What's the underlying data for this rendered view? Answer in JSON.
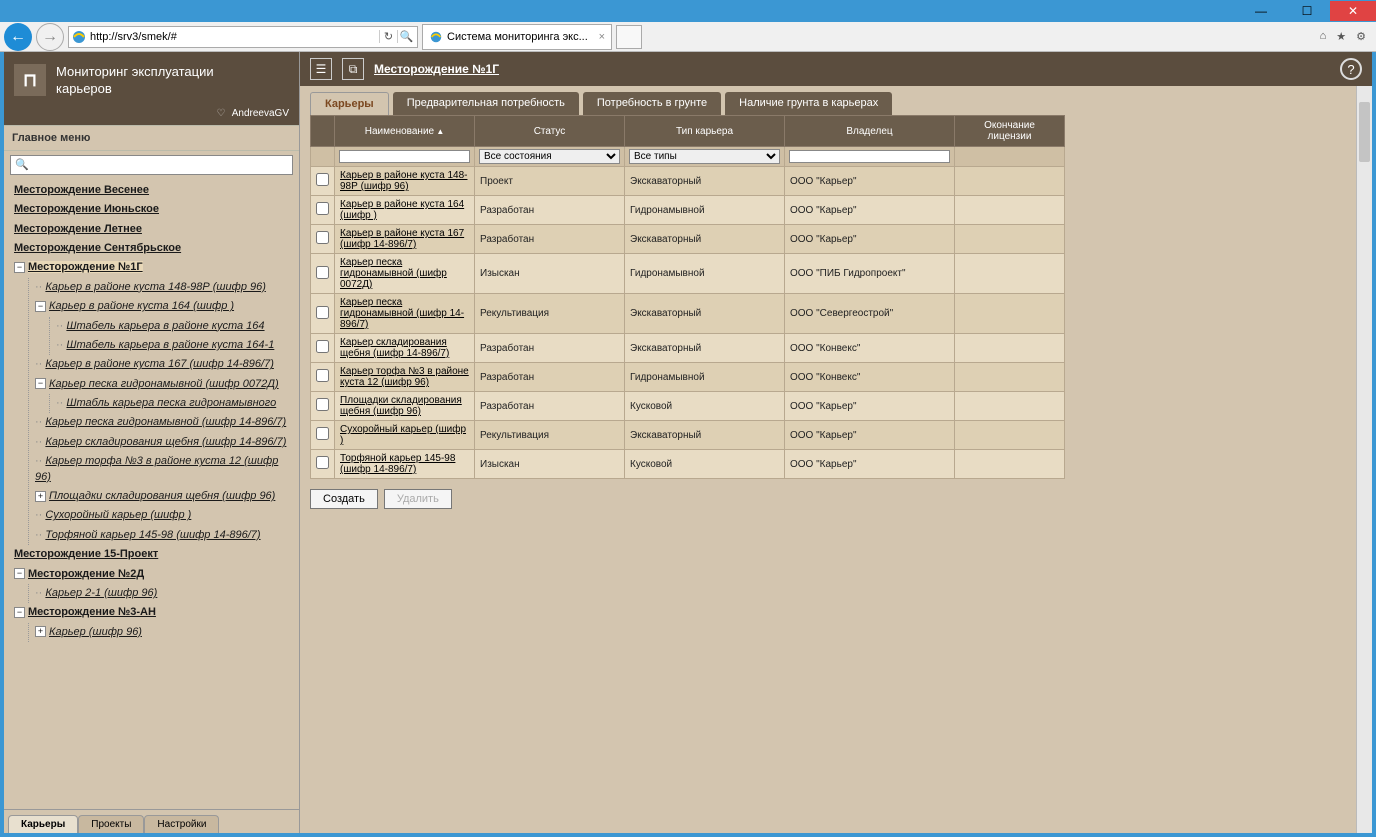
{
  "window": {
    "url": "http://srv3/smek/#",
    "tab_title": "Система мониторинга экс...",
    "tab_close": "×"
  },
  "app": {
    "title_l1": "Мониторинг эксплуатации",
    "title_l2": "карьеров",
    "user": "AndreevaGV"
  },
  "sidebar": {
    "menu_label": "Главное меню",
    "tabs": [
      "Карьеры",
      "Проекты",
      "Настройки"
    ],
    "tree": [
      {
        "label": "Месторождение Весенее",
        "bold": true
      },
      {
        "label": "Месторождение Июньское",
        "bold": true
      },
      {
        "label": "Месторождение Летнее",
        "bold": true
      },
      {
        "label": "Месторождение Сентябрьское",
        "bold": true
      },
      {
        "label": "Месторождение №1Г",
        "bold": true,
        "expanded": true,
        "selected": true,
        "children": [
          {
            "label": "Карьер в районе куста 148-98Р (шифр 96)",
            "italic": true,
            "leaf": true
          },
          {
            "label": "Карьер в районе куста 164 (шифр )",
            "italic": true,
            "expanded": true,
            "children": [
              {
                "label": "Штабель карьера в районе куста 164",
                "italic": true,
                "leaf": true
              },
              {
                "label": "Штабель карьера в районе куста 164-1",
                "italic": true,
                "leaf": true
              }
            ]
          },
          {
            "label": "Карьер в районе куста 167 (шифр 14-896/7)",
            "italic": true,
            "leaf": true
          },
          {
            "label": "Карьер песка гидронамывной (шифр 0072Д)",
            "italic": true,
            "expanded": true,
            "children": [
              {
                "label": "Штабль карьера песка гидронамывного",
                "italic": true,
                "leaf": true
              }
            ]
          },
          {
            "label": "Карьер песка гидронамывной (шифр 14-896/7)",
            "italic": true,
            "leaf": true
          },
          {
            "label": "Карьер складирования щебня (шифр 14-896/7)",
            "italic": true,
            "leaf": true
          },
          {
            "label": "Карьер торфа №3 в районе куста 12 (шифр 96)",
            "italic": true,
            "leaf": true
          },
          {
            "label": "Площадки складирования щебня (шифр 96)",
            "italic": true,
            "collapsed": true
          },
          {
            "label": "Сухоройный карьер (шифр )",
            "italic": true,
            "leaf": true
          },
          {
            "label": "Торфяной карьер 145-98 (шифр 14-896/7)",
            "italic": true,
            "leaf": true
          }
        ]
      },
      {
        "label": "Месторождение 15-Проект",
        "bold": true
      },
      {
        "label": "Месторождение №2Д",
        "bold": true,
        "expanded": true,
        "children": [
          {
            "label": "Карьер 2-1 (шифр 96)",
            "italic": true,
            "leaf": true
          }
        ]
      },
      {
        "label": "Месторождение №3-АН",
        "bold": true,
        "expanded": true,
        "children": [
          {
            "label": "Карьер (шифр 96)",
            "italic": true,
            "collapsed": true
          }
        ]
      }
    ]
  },
  "breadcrumb": {
    "title": "Месторождение №1Г"
  },
  "content_tabs": [
    "Карьеры",
    "Предварительная потребность",
    "Потребность в грунте",
    "Наличие грунта в карьерах"
  ],
  "grid": {
    "columns": [
      "Наименование",
      "Статус",
      "Тип карьера",
      "Владелец",
      "Окончание лицензии"
    ],
    "filter_status": "Все состояния",
    "filter_type": "Все типы",
    "rows": [
      {
        "name": "Карьер в районе куста 148-98Р (шифр 96)",
        "status": "Проект",
        "type": "Экскаваторный",
        "owner": "ООО \"Карьер\"",
        "lic": ""
      },
      {
        "name": "Карьер в районе куста 164 (шифр )",
        "status": "Разработан",
        "type": "Гидронамывной",
        "owner": "ООО \"Карьер\"",
        "lic": ""
      },
      {
        "name": "Карьер в районе куста 167 (шифр 14-896/7)",
        "status": "Разработан",
        "type": "Экскаваторный",
        "owner": "ООО \"Карьер\"",
        "lic": ""
      },
      {
        "name": "Карьер песка гидронамывной (шифр 0072Д)",
        "status": "Изыскан",
        "type": "Гидронамывной",
        "owner": "ООО \"ПИБ Гидропроект\"",
        "lic": ""
      },
      {
        "name": "Карьер песка гидронамывной (шифр 14-896/7)",
        "status": "Рекультивация",
        "type": "Экскаваторный",
        "owner": "ООО \"Севергеострой\"",
        "lic": ""
      },
      {
        "name": "Карьер складирования щебня (шифр 14-896/7)",
        "status": "Разработан",
        "type": "Экскаваторный",
        "owner": "ООО \"Конвекс\"",
        "lic": ""
      },
      {
        "name": "Карьер торфа №3 в районе куста 12 (шифр 96)",
        "status": "Разработан",
        "type": "Гидронамывной",
        "owner": "ООО \"Конвекс\"",
        "lic": ""
      },
      {
        "name": "Площадки складирования щебня (шифр 96)",
        "status": "Разработан",
        "type": "Кусковой",
        "owner": "ООО \"Карьер\"",
        "lic": ""
      },
      {
        "name": "Сухоройный карьер (шифр )",
        "status": "Рекультивация",
        "type": "Экскаваторный",
        "owner": "ООО \"Карьер\"",
        "lic": ""
      },
      {
        "name": "Торфяной карьер 145-98 (шифр 14-896/7)",
        "status": "Изыскан",
        "type": "Кусковой",
        "owner": "ООО \"Карьер\"",
        "lic": ""
      }
    ]
  },
  "actions": {
    "create": "Создать",
    "delete": "Удалить"
  }
}
